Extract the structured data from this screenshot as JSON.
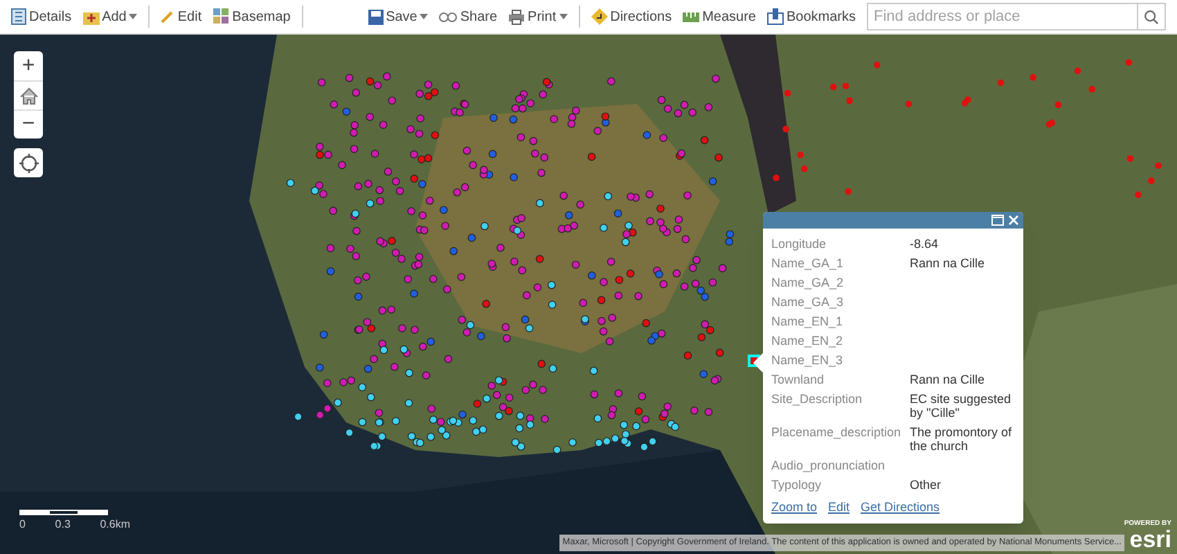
{
  "toolbar": {
    "left": [
      {
        "kind": "details",
        "label": "Details",
        "caret": false
      },
      {
        "kind": "add",
        "label": "Add",
        "caret": true
      },
      {
        "kind": "edit",
        "label": "Edit",
        "caret": false
      },
      {
        "kind": "basemap",
        "label": "Basemap",
        "caret": false
      }
    ],
    "right": [
      {
        "kind": "save",
        "label": "Save",
        "caret": true
      },
      {
        "kind": "share",
        "label": "Share",
        "caret": false
      },
      {
        "kind": "print",
        "label": "Print",
        "caret": true
      },
      {
        "kind": "directions",
        "label": "Directions",
        "caret": false
      },
      {
        "kind": "measure",
        "label": "Measure",
        "caret": false
      },
      {
        "kind": "bookmarks",
        "label": "Bookmarks",
        "caret": false
      }
    ],
    "search": {
      "placeholder": "Find address or place"
    }
  },
  "map_controls": [
    {
      "kind": "zoom-in",
      "label": "+"
    },
    {
      "kind": "home"
    },
    {
      "kind": "zoom-out",
      "label": "−"
    },
    {
      "kind": "locate"
    }
  ],
  "popup": {
    "fields": [
      {
        "name": "Longitude",
        "value": "-8.64"
      },
      {
        "name": "Name_GA_1",
        "value": "Rann na Cille"
      },
      {
        "name": "Name_GA_2"
      },
      {
        "name": "Name_GA_3"
      },
      {
        "name": "Name_EN_1"
      },
      {
        "name": "Name_EN_2"
      },
      {
        "name": "Name_EN_3"
      },
      {
        "name": "Townland",
        "value": "Rann na Cille"
      },
      {
        "name": "Site_Description",
        "value": "EC site suggested by \"Cille\""
      },
      {
        "name": "Placename_description",
        "value": "The promontory of the church"
      },
      {
        "name": "Audio_pronunciation"
      },
      {
        "name": "Typology",
        "value": "Other"
      }
    ],
    "actions": [
      "Zoom to",
      "Edit",
      "Get Directions"
    ]
  },
  "scale_bar": {
    "ticks": [
      "0",
      "0.3",
      "0.6km"
    ]
  },
  "attribution": "Maxar, Microsoft | Copyright Government of Ireland. The content of this application is owned and operated by National Monuments Service...",
  "logo": {
    "caption": "POWERED BY",
    "name": "esri"
  }
}
